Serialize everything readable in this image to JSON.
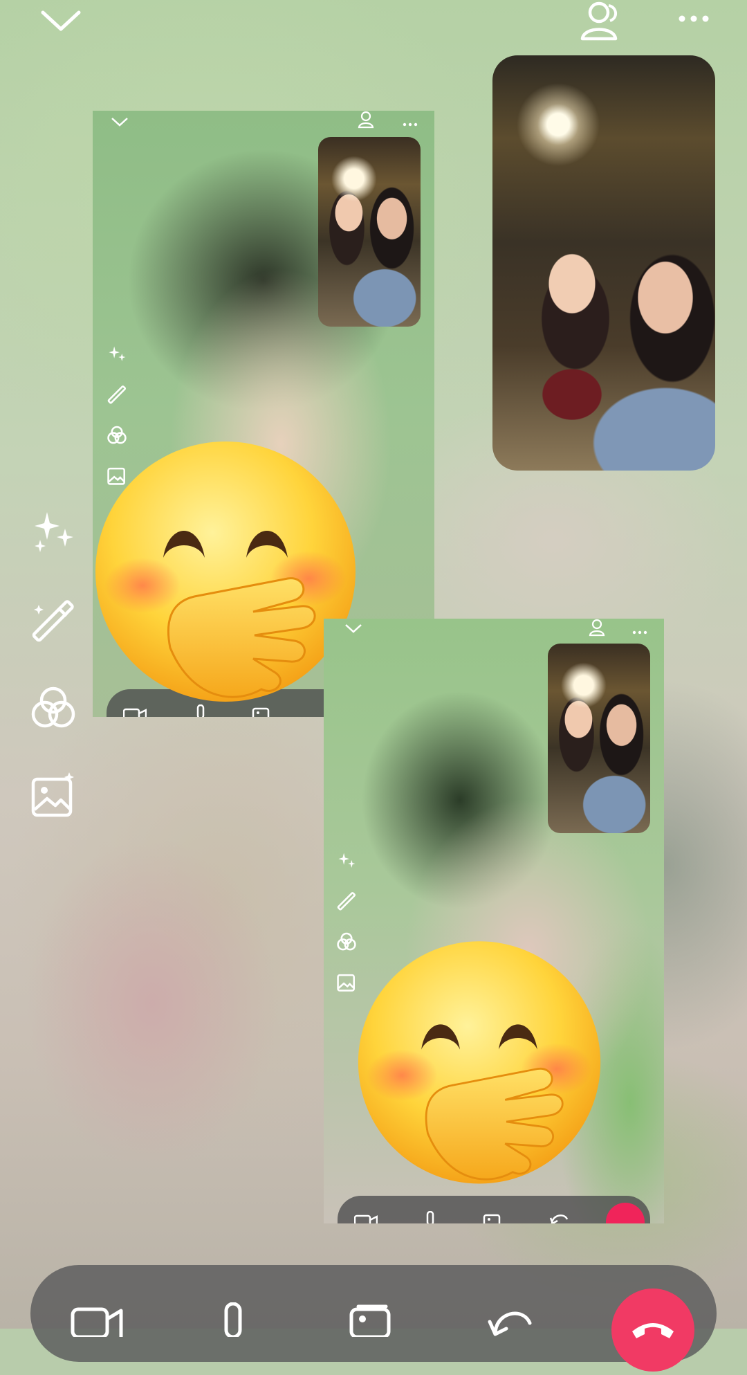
{
  "screen": {
    "type": "video-call",
    "accent_color": "#f13a64",
    "bar_color": "#5a5a5c"
  },
  "top_bar": {
    "collapse_icon": "chevron-down-icon",
    "participants_icon": "add-person-icon",
    "more_icon": "more-dots-icon"
  },
  "effects_toolbar": {
    "items": [
      {
        "icon": "sparkles-icon"
      },
      {
        "icon": "magic-wand-icon"
      },
      {
        "icon": "filters-icon"
      },
      {
        "icon": "background-image-icon"
      }
    ]
  },
  "controls": {
    "items": [
      {
        "icon": "camera-icon"
      },
      {
        "icon": "microphone-icon"
      },
      {
        "icon": "gallery-icon"
      },
      {
        "icon": "flip-camera-icon"
      },
      {
        "icon": "end-call-icon"
      }
    ]
  },
  "overlays": {
    "sticker": "face-with-hand-over-mouth-emoji"
  }
}
